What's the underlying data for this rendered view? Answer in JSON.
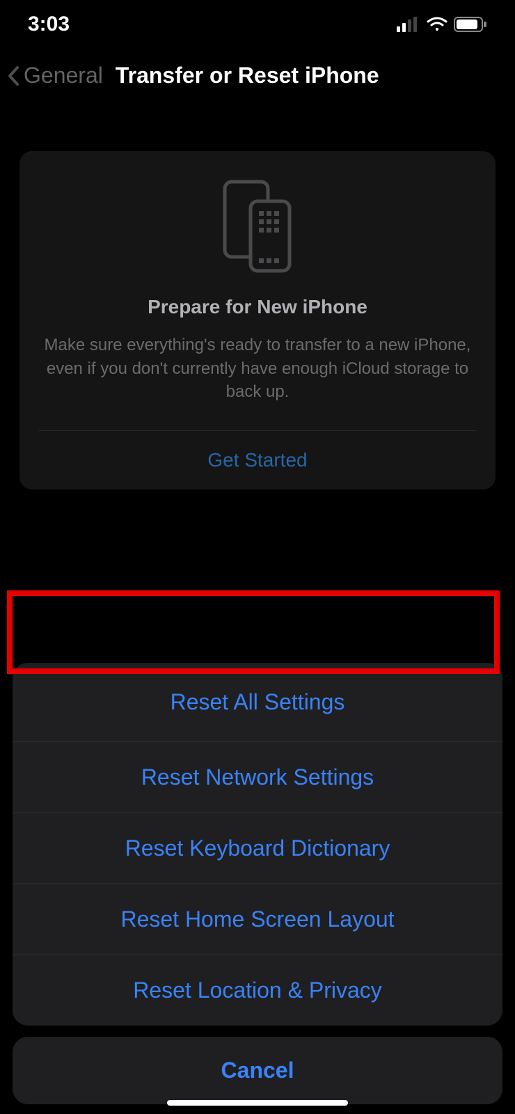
{
  "status": {
    "time": "3:03"
  },
  "nav": {
    "back_label": "General",
    "title": "Transfer or Reset iPhone"
  },
  "prepare_card": {
    "title": "Prepare for New iPhone",
    "description": "Make sure everything's ready to transfer to a new iPhone, even if you don't currently have enough iCloud storage to back up.",
    "action_label": "Get Started"
  },
  "action_sheet": {
    "items": [
      {
        "label": "Reset All Settings",
        "highlighted": true
      },
      {
        "label": "Reset Network Settings",
        "highlighted": false
      },
      {
        "label": "Reset Keyboard Dictionary",
        "highlighted": false
      },
      {
        "label": "Reset Home Screen Layout",
        "highlighted": false
      },
      {
        "label": "Reset Location & Privacy",
        "highlighted": false
      }
    ],
    "cancel_label": "Cancel"
  }
}
